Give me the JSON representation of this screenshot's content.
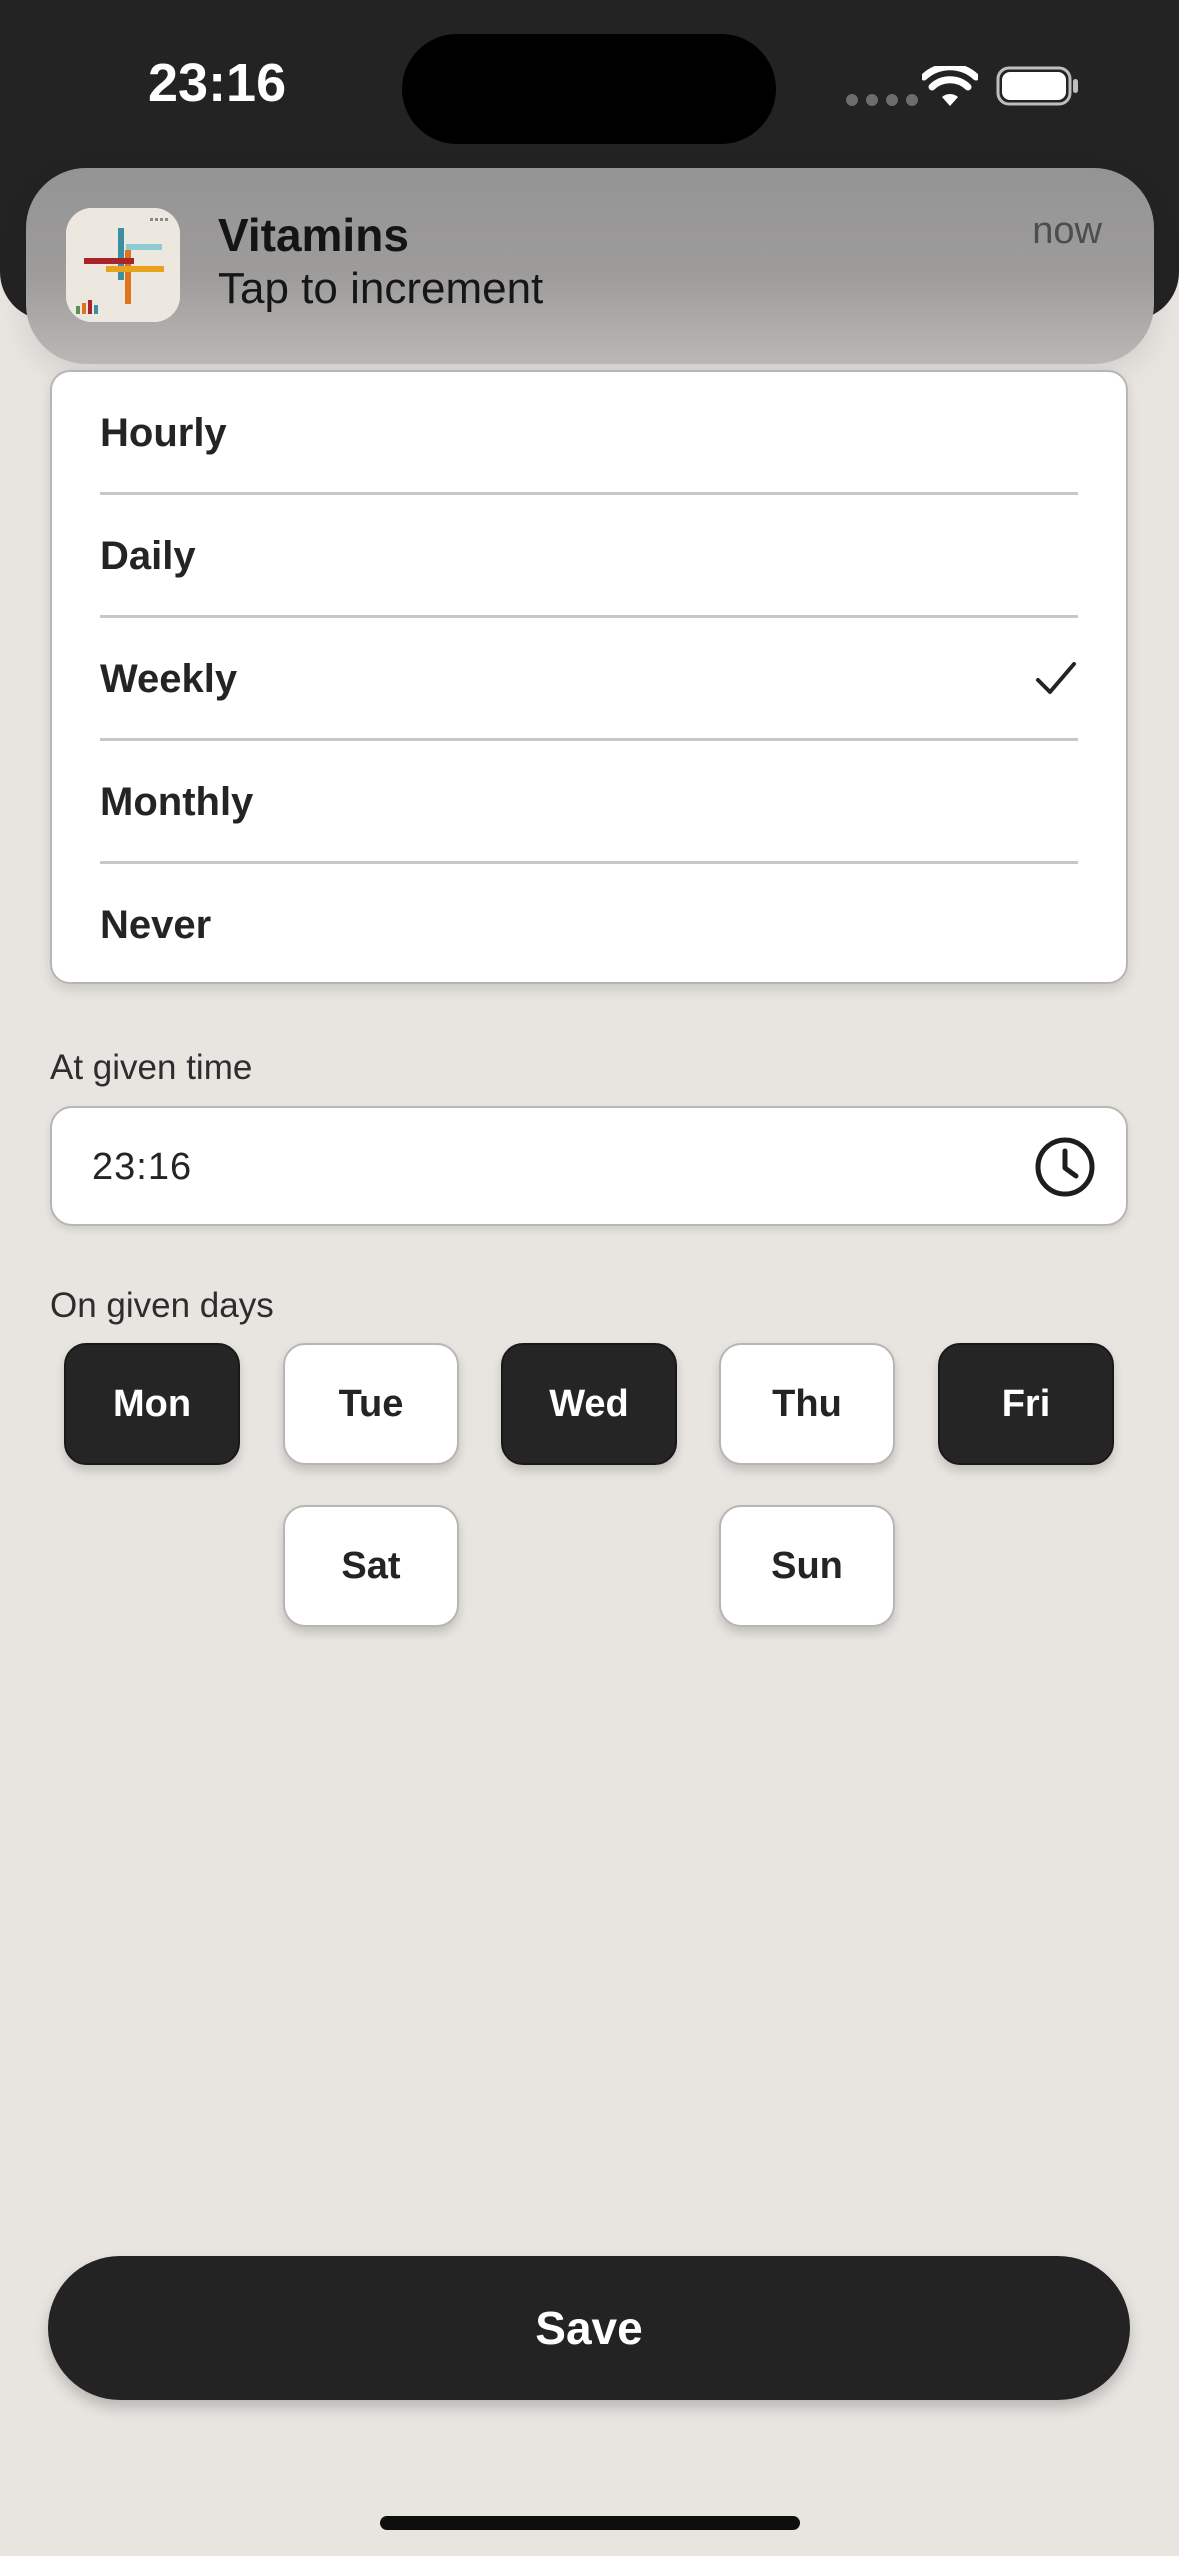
{
  "status_bar": {
    "time": "23:16"
  },
  "notification": {
    "app_icon": "app-cross-icon",
    "title": "Vitamins",
    "body": "Tap to increment",
    "time": "now"
  },
  "frequency": {
    "options": [
      {
        "label": "Hourly",
        "selected": false
      },
      {
        "label": "Daily",
        "selected": false
      },
      {
        "label": "Weekly",
        "selected": true
      },
      {
        "label": "Monthly",
        "selected": false
      },
      {
        "label": "Never",
        "selected": false
      }
    ]
  },
  "time_section": {
    "label": "At given time",
    "value": "23:16",
    "icon": "clock-icon"
  },
  "days_section": {
    "label": "On given days",
    "days": [
      {
        "label": "Mon",
        "selected": true
      },
      {
        "label": "Tue",
        "selected": false
      },
      {
        "label": "Wed",
        "selected": true
      },
      {
        "label": "Thu",
        "selected": false
      },
      {
        "label": "Fri",
        "selected": true
      },
      {
        "label": "Sat",
        "selected": false
      },
      {
        "label": "Sun",
        "selected": false
      }
    ]
  },
  "save_label": "Save",
  "colors": {
    "background": "#E8E5E1",
    "dark": "#242324",
    "white": "#FFFFFF"
  }
}
